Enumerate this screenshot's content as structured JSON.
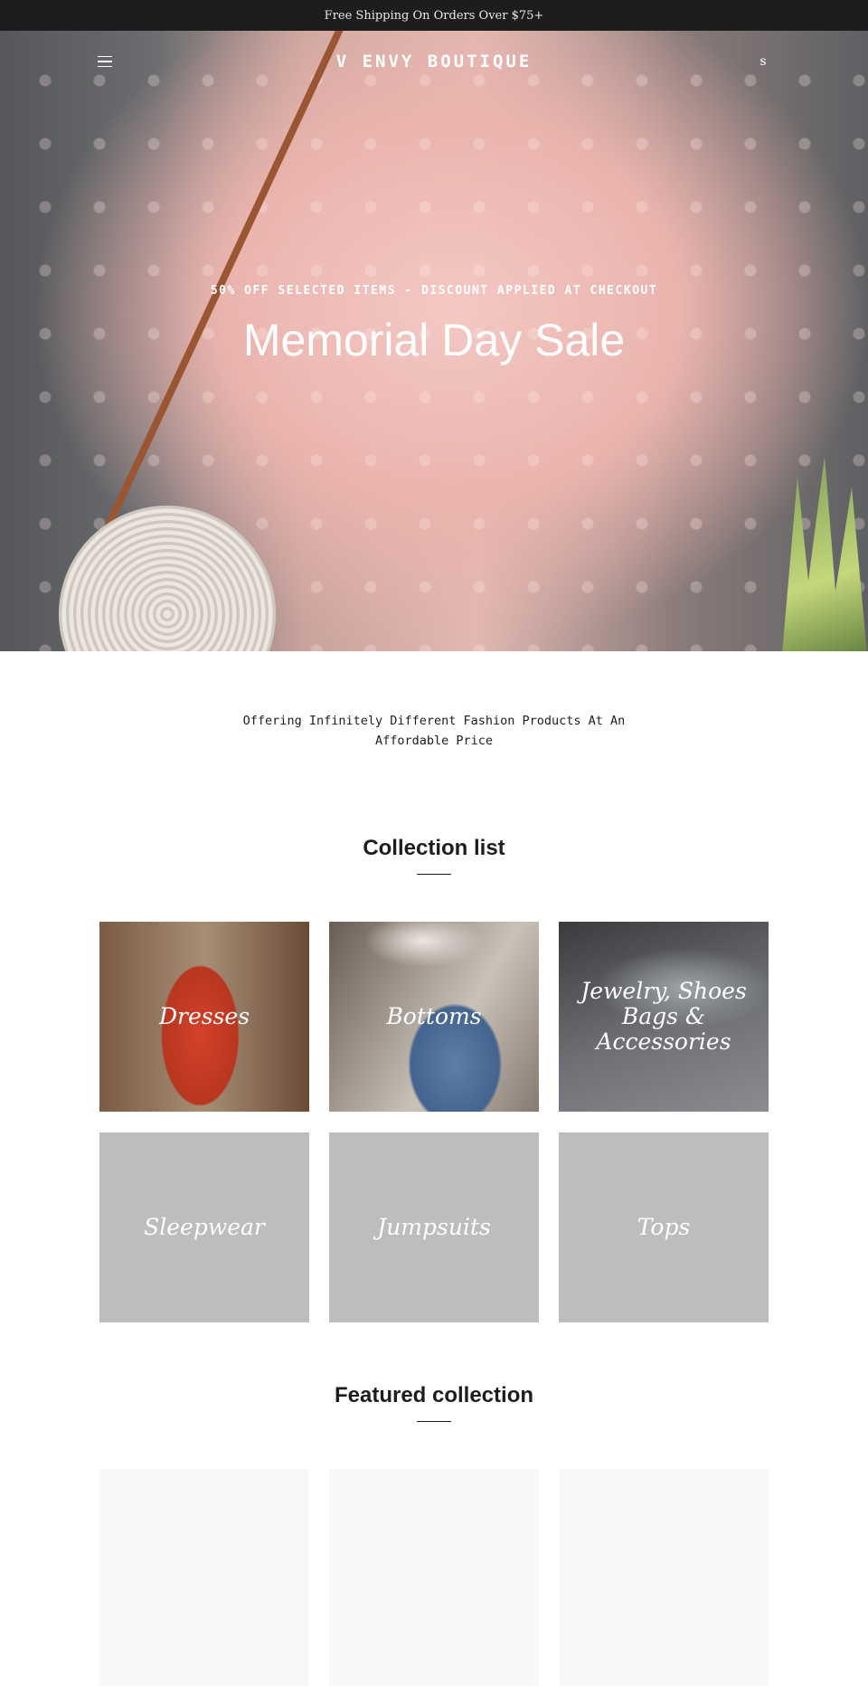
{
  "announcement": {
    "text": "Free Shipping On Orders Over $75+"
  },
  "header": {
    "logo": "V ENVY BOUTIQUE",
    "search_glyph": "s",
    "menu_icon": "hamburger-icon"
  },
  "hero": {
    "subtitle": "50% OFF SELECTED ITEMS - DISCOUNT APPLIED AT CHECKOUT",
    "title": "Memorial Day Sale",
    "slide_count": 6,
    "active_slide": 1,
    "pause_glyph": "0"
  },
  "tagline": "Offering Infinitely Different Fashion Products At An Affordable Price",
  "collection_list": {
    "title": "Collection list",
    "items": [
      {
        "label": "Dresses"
      },
      {
        "label": "Bottoms"
      },
      {
        "label": "Jewelry, Shoes Bags & Accessories"
      },
      {
        "label": "Sleepwear"
      },
      {
        "label": "Jumpsuits"
      },
      {
        "label": "Tops"
      }
    ]
  },
  "featured_collection": {
    "title": "Featured collection"
  },
  "colors": {
    "announcement_bg": "#1c1d1d",
    "placeholder_tile": "#bdbdbd"
  }
}
